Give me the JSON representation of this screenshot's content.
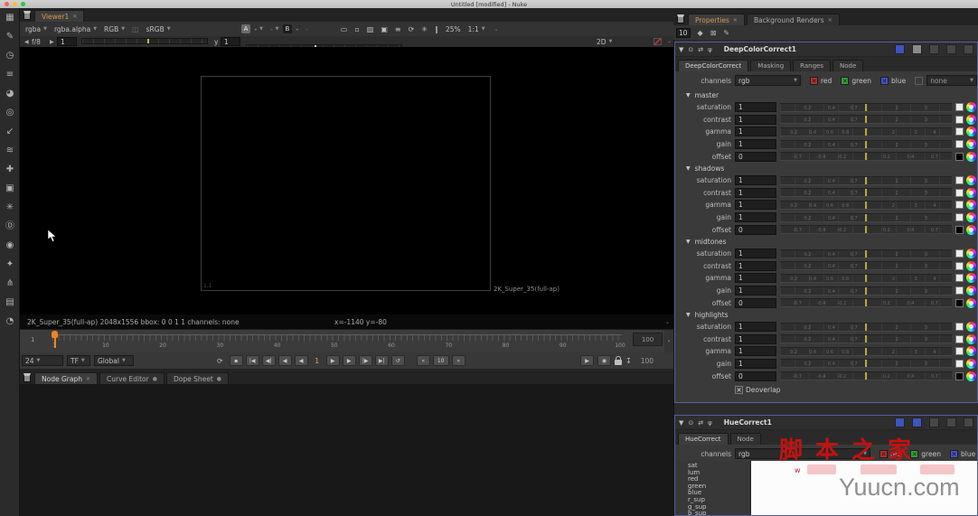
{
  "titlebar": {
    "title": "Untitled [modified] - Nuke"
  },
  "left_toolbar": {
    "icons": [
      {
        "name": "image",
        "glyph": "▦"
      },
      {
        "name": "draw",
        "glyph": "✎"
      },
      {
        "name": "time",
        "glyph": "◷"
      },
      {
        "name": "channel",
        "glyph": "≡"
      },
      {
        "name": "color",
        "glyph": "◕"
      },
      {
        "name": "filter",
        "glyph": "◎"
      },
      {
        "name": "keyer",
        "glyph": "↙"
      },
      {
        "name": "merge",
        "glyph": "≋"
      },
      {
        "name": "transform",
        "glyph": "✚"
      },
      {
        "name": "3d",
        "glyph": "▣"
      },
      {
        "name": "particles",
        "glyph": "✳"
      },
      {
        "name": "deep",
        "glyph": "Ⓓ"
      },
      {
        "name": "views",
        "glyph": "◉"
      },
      {
        "name": "metadata",
        "glyph": "✦"
      },
      {
        "name": "toolsets",
        "glyph": "⋔"
      },
      {
        "name": "other",
        "glyph": "▤"
      },
      {
        "name": "ofx",
        "glyph": "◔"
      }
    ]
  },
  "viewer": {
    "tab_label": "Viewer1",
    "close_glyph": "✕",
    "toolbar1": {
      "layer": "rgba",
      "alpha_layer": "rgba.alpha",
      "display_channels": "RGB",
      "colorspace": "sRGB",
      "a_label": "A",
      "a_value": "-",
      "mid_value": "-",
      "b_label": "B",
      "b_value": "-",
      "b_value2": "-",
      "icons": [
        {
          "name": "proxy",
          "glyph": "▭"
        },
        {
          "name": "format",
          "glyph": "▫"
        },
        {
          "name": "wipe",
          "glyph": "▨"
        },
        {
          "name": "layers",
          "glyph": "▣"
        },
        {
          "name": "stereo",
          "glyph": "≡"
        },
        {
          "name": "refresh",
          "glyph": "⟳"
        },
        {
          "name": "gear",
          "glyph": "✳"
        },
        {
          "name": "pause",
          "glyph": "‖"
        }
      ],
      "zoom": "25%",
      "ratio": "1:1"
    },
    "toolbar2": {
      "prev_glyph": "◀",
      "gain_label": "f/8",
      "next_glyph": "▶",
      "gain_value": "1",
      "gamma_label": "y",
      "gamma_value": "1",
      "mode": "2D"
    },
    "viewport": {
      "format_label": "2K_Super_35(full-ap)",
      "corner_label": "1,1"
    },
    "infobar": {
      "left": "2K_Super_35(full-ap) 2048x1556  bbox: 0 0 1 1 channels: none",
      "coords": "x=-1140 y=-80"
    },
    "timeline": {
      "in_value": "1",
      "ticks": [
        "1",
        "10",
        "20",
        "30",
        "40",
        "50",
        "60",
        "70",
        "80",
        "90",
        "100"
      ],
      "out_value": "100"
    },
    "transport": {
      "fps": "24",
      "tf": "TF",
      "range_mode": "Global",
      "loop_glyph": "⟳",
      "back_buttons": [
        {
          "name": "stop",
          "glyph": "▪"
        },
        {
          "name": "go-start",
          "glyph": "|◀"
        },
        {
          "name": "prev-keyframe",
          "glyph": "◀|"
        },
        {
          "name": "step-back",
          "glyph": "◀"
        },
        {
          "name": "play-back",
          "glyph": "◀"
        }
      ],
      "current_frame": "1",
      "fwd_buttons": [
        {
          "name": "play",
          "glyph": "▶"
        },
        {
          "name": "step-fwd",
          "glyph": "▶"
        },
        {
          "name": "next-keyframe",
          "glyph": "|▶"
        },
        {
          "name": "go-end",
          "glyph": "▶|"
        },
        {
          "name": "loop-current",
          "glyph": "↺"
        }
      ],
      "dec_glyph": "«",
      "frame_step": "10",
      "inc_glyph": "»",
      "flipbook_glyph": "▶",
      "render_glyph": "◉",
      "export_glyph": "↧",
      "out_value": "100"
    }
  },
  "bottom_tabs": {
    "tabs": [
      {
        "label": "Node Graph",
        "active": true,
        "close": "✕"
      },
      {
        "label": "Curve Editor",
        "active": false,
        "close": "●"
      },
      {
        "label": "Dope Sheet",
        "active": false,
        "close": "●"
      }
    ]
  },
  "right_panel": {
    "tabs": [
      {
        "label": "Properties",
        "active": true,
        "close": "✕"
      },
      {
        "label": "Background Renders",
        "active": false,
        "close": "✕"
      }
    ],
    "toolbar": {
      "max_panels": "10",
      "icons": [
        {
          "name": "pin",
          "glyph": "◆"
        },
        {
          "name": "clear-all",
          "glyph": "⊠"
        },
        {
          "name": "edit",
          "glyph": "✎"
        }
      ]
    },
    "deep_panel": {
      "title": "DeepColorCorrect1",
      "header_icons_left": [
        {
          "name": "collapse",
          "glyph": "▼"
        },
        {
          "name": "center",
          "glyph": "⊙"
        },
        {
          "name": "switch",
          "glyph": "⇄"
        },
        {
          "name": "pin",
          "glyph": "ψ"
        }
      ],
      "header_buttons": [
        {
          "name": "minimize",
          "style": "blue"
        },
        {
          "name": "revert",
          "style": "gray"
        },
        {
          "name": "extra-1",
          "style": "dim"
        },
        {
          "name": "extra-2",
          "style": "dim"
        },
        {
          "name": "close",
          "style": "dim"
        }
      ],
      "tabs": [
        {
          "label": "DeepColorCorrect",
          "active": true
        },
        {
          "label": "Masking",
          "active": false
        },
        {
          "label": "Ranges",
          "active": false
        },
        {
          "label": "Node",
          "active": false
        }
      ],
      "channels_label": "channels",
      "channels_value": "rgb",
      "channel_boxes": [
        {
          "label": "red",
          "color": "red"
        },
        {
          "label": "green",
          "color": "green"
        },
        {
          "label": "blue",
          "color": "blue"
        }
      ],
      "none_value": "none",
      "sections": [
        {
          "name": "master",
          "rows": [
            {
              "label": "saturation",
              "value": "1",
              "type": "mult"
            },
            {
              "label": "contrast",
              "value": "1",
              "type": "mult"
            },
            {
              "label": "gamma",
              "value": "1",
              "type": "gamma"
            },
            {
              "label": "gain",
              "value": "1",
              "type": "mult"
            },
            {
              "label": "offset",
              "value": "0",
              "type": "offset"
            }
          ]
        },
        {
          "name": "shadows",
          "rows": [
            {
              "label": "saturation",
              "value": "1",
              "type": "mult"
            },
            {
              "label": "contrast",
              "value": "1",
              "type": "mult"
            },
            {
              "label": "gamma",
              "value": "1",
              "type": "gamma"
            },
            {
              "label": "gain",
              "value": "1",
              "type": "mult"
            },
            {
              "label": "offset",
              "value": "0",
              "type": "offset"
            }
          ]
        },
        {
          "name": "midtones",
          "rows": [
            {
              "label": "saturation",
              "value": "1",
              "type": "mult"
            },
            {
              "label": "contrast",
              "value": "1",
              "type": "mult"
            },
            {
              "label": "gamma",
              "value": "1",
              "type": "gamma"
            },
            {
              "label": "gain",
              "value": "1",
              "type": "mult"
            },
            {
              "label": "offset",
              "value": "0",
              "type": "offset"
            }
          ]
        },
        {
          "name": "highlights",
          "rows": [
            {
              "label": "saturation",
              "value": "1",
              "type": "mult"
            },
            {
              "label": "contrast",
              "value": "1",
              "type": "mult"
            },
            {
              "label": "gamma",
              "value": "1",
              "type": "gamma"
            },
            {
              "label": "gain",
              "value": "1",
              "type": "mult"
            },
            {
              "label": "offset",
              "value": "0",
              "type": "offset"
            }
          ]
        }
      ],
      "tick_labels": {
        "mult": [
          {
            "t": "0.2",
            "p": 16
          },
          {
            "t": "0.4",
            "p": 30
          },
          {
            "t": "0.7",
            "p": 43
          },
          {
            "t": "2",
            "p": 68
          },
          {
            "t": "3",
            "p": 85
          }
        ],
        "gamma": [
          {
            "t": "0.2",
            "p": 8
          },
          {
            "t": "0.4",
            "p": 19
          },
          {
            "t": "0.6",
            "p": 29
          },
          {
            "t": "0.8",
            "p": 38
          },
          {
            "t": "2",
            "p": 66
          },
          {
            "t": "3",
            "p": 79
          },
          {
            "t": "4",
            "p": 90
          }
        ],
        "offset": [
          {
            "t": "-0.7",
            "p": 10
          },
          {
            "t": "-0.4",
            "p": 24
          },
          {
            "t": "-0.2",
            "p": 36
          },
          {
            "t": "0.2",
            "p": 62
          },
          {
            "t": "0.4",
            "p": 76
          },
          {
            "t": "0.7",
            "p": 90
          }
        ]
      },
      "deoverlap_label": "Deoverlap",
      "check_glyph": "✕"
    },
    "hue_panel": {
      "title": "HueCorrect1",
      "header_icons_left": [
        {
          "name": "collapse",
          "glyph": "▼"
        },
        {
          "name": "center",
          "glyph": "⊙"
        },
        {
          "name": "switch",
          "glyph": "⇄"
        },
        {
          "name": "pin",
          "glyph": "ψ"
        }
      ],
      "header_buttons": [
        {
          "name": "minimize",
          "style": "blue"
        },
        {
          "name": "float",
          "style": "blue"
        },
        {
          "name": "extra-1",
          "style": "dim"
        },
        {
          "name": "extra-2",
          "style": "dim"
        },
        {
          "name": "close",
          "style": "dim"
        }
      ],
      "tabs": [
        {
          "label": "HueCorrect",
          "active": true
        },
        {
          "label": "Node",
          "active": false
        }
      ],
      "channels_label": "channels",
      "channels_value": "rgb",
      "channel_boxes": [
        {
          "label": "red",
          "color": "red"
        },
        {
          "label": "green",
          "color": "green"
        },
        {
          "label": "blue",
          "color": "blue"
        }
      ],
      "curves": [
        "sat",
        "lum",
        "red",
        "green",
        "blue",
        "r_sup",
        "g_sup",
        "b_sup"
      ]
    }
  },
  "watermark": {
    "cn": "脚本之家",
    "prefix": "w",
    "site": "Yuucn.com"
  },
  "colors": {
    "accent_orange": "#cf9a4f",
    "playhead": "#f28322",
    "focus_border": "#565d9e",
    "check_red": "#b13131",
    "check_green": "#35a035",
    "check_blue": "#4853c4"
  }
}
